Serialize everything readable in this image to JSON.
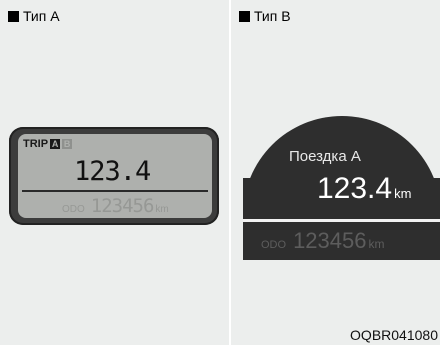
{
  "type_a": {
    "label": "Тип A",
    "trip_label": "TRIP",
    "trip_selector": [
      "A",
      "B"
    ],
    "trip_value": "123.4",
    "odo_label": "ODO",
    "odo_value": "123456",
    "odo_unit": "km"
  },
  "type_b": {
    "label": "Тип B",
    "title": "Поездка A",
    "trip_value": "123.4",
    "trip_unit": "km",
    "odo_label": "ODO",
    "odo_value": "123456",
    "odo_unit": "km"
  },
  "figure_code": "OQBR041080"
}
